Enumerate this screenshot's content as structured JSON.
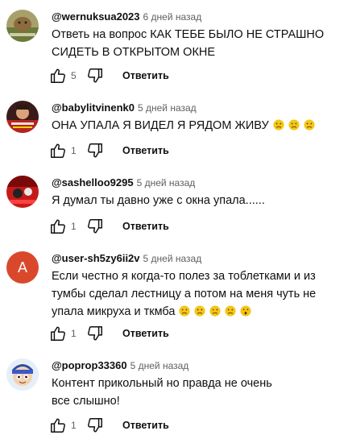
{
  "colors": {
    "text": "#0f0f0f",
    "meta": "#606060",
    "emoji": "#f5c518",
    "avatar_letter_bg": "#d9482b"
  },
  "icons": {
    "like": "thumb-up-icon",
    "dislike": "thumb-down-icon",
    "emoji": "sad-face-icon"
  },
  "comments": [
    {
      "author": "@wernuksua2023",
      "time": "6 дней назад",
      "text": "Ответь на вопрос КАК ТЕБЕ БЫЛО НЕ СТРАШНО СИДЕТЬ В ОТКРЫТОМ ОКНЕ",
      "likes": "5",
      "reply": "Ответить"
    },
    {
      "author": "@babylitvinenk0",
      "time": "5 дней назад",
      "text": "ОНА УПАЛА Я ВИДЕЛ Я РЯДОМ ЖИВУ",
      "likes": "1",
      "reply": "Ответить"
    },
    {
      "author": "@sashelloo9295",
      "time": "5 дней назад",
      "text": "Я думал ты давно уже с окна упала......",
      "likes": "1",
      "reply": "Ответить"
    },
    {
      "author": "@user-sh5zy6ii2v",
      "avatar_letter": "A",
      "time": "5 дней назад",
      "text": "Если честно я когда-то полез за тоблетками и из тумбы сделал лестницу а потом на меня чуть не упала микруха и ткмба",
      "likes": "1",
      "reply": "Ответить"
    },
    {
      "author": "@poprop33360",
      "time": "5 дней назад",
      "text": "Контент прикольный но правда не очень все слышно!",
      "likes": "1",
      "reply": "Ответить"
    }
  ]
}
